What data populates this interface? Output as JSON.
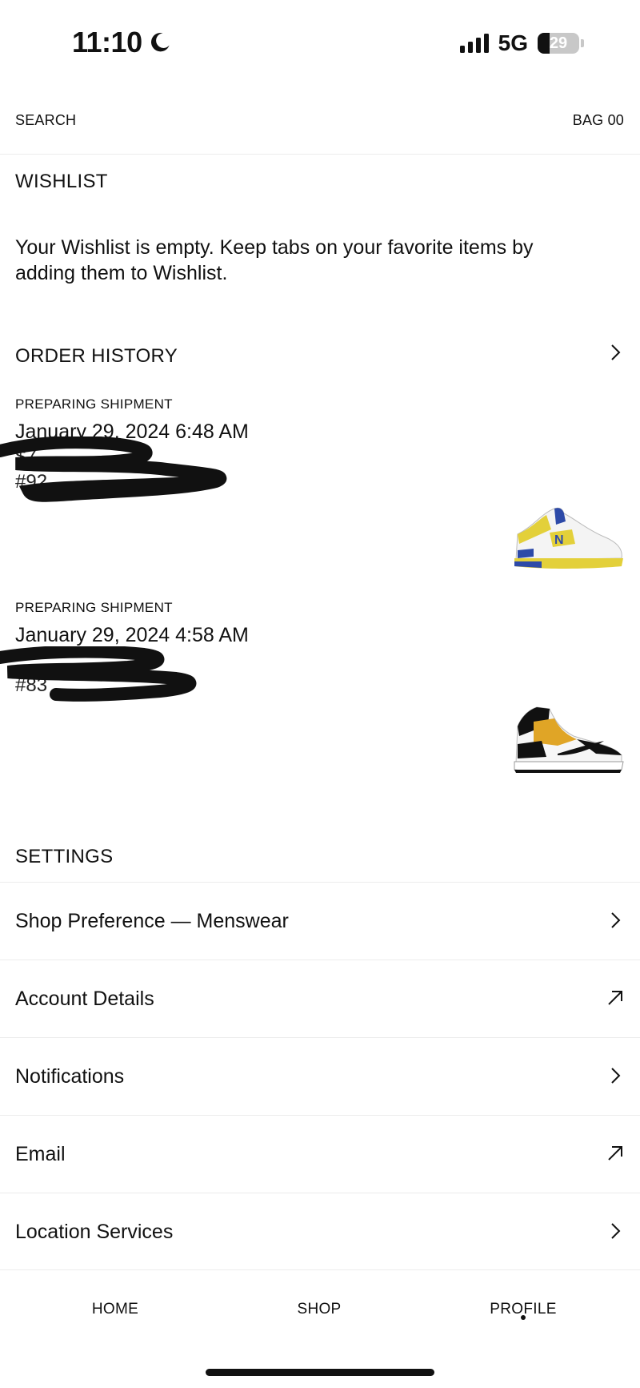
{
  "status_bar": {
    "time": "11:10",
    "network": "5G",
    "battery": "29",
    "battery_level": 0.29
  },
  "top_nav": {
    "search": "SEARCH",
    "bag": "BAG 00"
  },
  "wishlist": {
    "title": "WISHLIST",
    "empty_line1": "Your Wishlist is empty. Keep tabs on your favorite items by",
    "empty_line2": "adding them to Wishlist."
  },
  "order_history": {
    "title": "ORDER HISTORY",
    "orders": [
      {
        "status": "PREPARING SHIPMENT",
        "date": "January 29, 2024 6:48 AM",
        "price": "$7",
        "number": "#92",
        "product_icon": "sneaker-white-yellow-blue-icon"
      },
      {
        "status": "PREPARING SHIPMENT",
        "date": "January 29, 2024 4:58 AM",
        "price": "",
        "number": "#83",
        "product_icon": "sneaker-black-yellow-icon"
      }
    ]
  },
  "settings": {
    "title": "SETTINGS",
    "items": [
      {
        "label": "Shop Preference — Menswear",
        "icon": "chevron-right-icon"
      },
      {
        "label": "Account Details",
        "icon": "external-arrow-icon"
      },
      {
        "label": "Notifications",
        "icon": "chevron-right-icon"
      },
      {
        "label": "Email",
        "icon": "external-arrow-icon"
      },
      {
        "label": "Location Services",
        "icon": "chevron-right-icon"
      }
    ]
  },
  "tab_bar": {
    "home": "HOME",
    "shop": "SHOP",
    "profile": "PROFILE",
    "active": "PROFILE"
  }
}
